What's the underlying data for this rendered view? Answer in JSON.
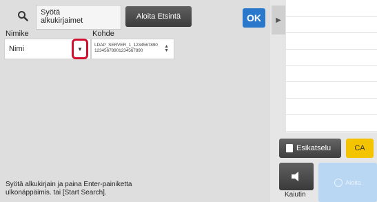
{
  "search": {
    "placeholder_line1": "Syötä",
    "placeholder_line2": "alkukirjaimet",
    "start_search_label": "Aloita Etsintä",
    "ok_label": "OK"
  },
  "fields": {
    "title_label": "Nimike",
    "title_value": "Nimi",
    "target_label": "Kohde",
    "target_line1": "LDAP_SERVER_1_1234567890",
    "target_line2": "12345678901234567890"
  },
  "hint": {
    "line1": "Syötä alkukirjain ja paina Enter-painiketta",
    "line2": "ulkonäppäimis. tai [Start Search]."
  },
  "side": {
    "preview_label": "Esikatselu",
    "ca_label": "CA",
    "speaker_label": "Kaiutin",
    "start_label": "Aloita"
  },
  "colors": {
    "ok_blue": "#2a78cc",
    "highlight_red": "#d0102e",
    "ca_yellow": "#f5c400",
    "start_disabled_blue": "#b9d7f2"
  }
}
